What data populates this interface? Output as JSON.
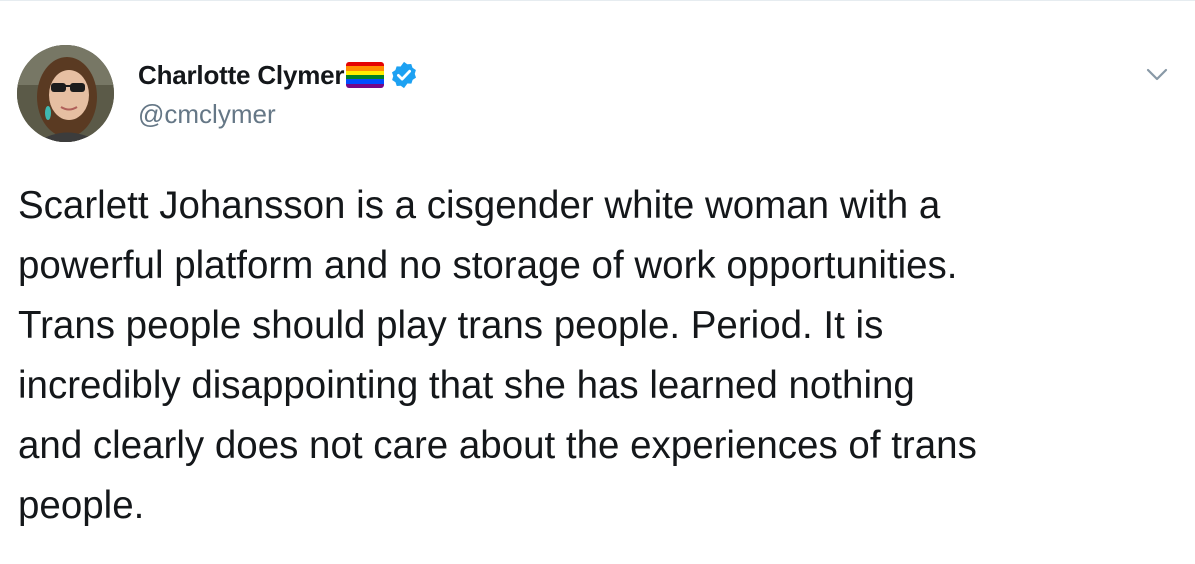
{
  "author": {
    "display_name": "Charlotte Clymer",
    "handle": "@cmclymer",
    "avatar_icon": "profile-photo",
    "flag_icon": "rainbow-flag-emoji",
    "verified_icon": "verified-badge-icon"
  },
  "menu": {
    "caret_icon": "chevron-down-icon"
  },
  "tweet": {
    "lines": [
      "Scarlett Johansson is a cisgender white woman with a",
      "powerful platform and no storage of work opportunities.",
      "Trans people should play trans people. Period. It is",
      "incredibly disappointing that she has learned nothing",
      "and clearly does not care about the experiences of trans",
      "people."
    ]
  },
  "colors": {
    "text": "#14171a",
    "secondary_text": "#657786",
    "verified_blue": "#1da1f2",
    "rainbow": [
      "#e40303",
      "#ff8c00",
      "#ffed00",
      "#008026",
      "#004dff",
      "#750787"
    ]
  }
}
